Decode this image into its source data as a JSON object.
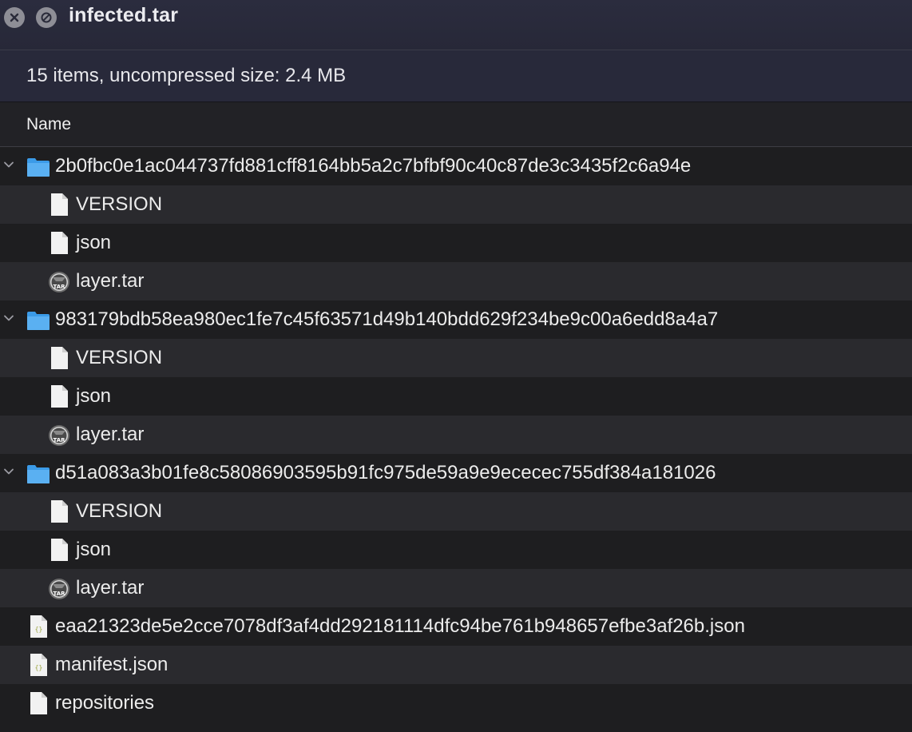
{
  "window": {
    "title": "infected.tar"
  },
  "info": {
    "summary": "15 items, uncompressed size: 2.4 MB"
  },
  "columns": {
    "name": "Name"
  },
  "colors": {
    "folder": "#3b9be8",
    "file": "#f2f2f2",
    "archive": "#6c6c6c"
  },
  "rows": [
    {
      "label": "2b0fbc0e1ac044737fd881cff8164bb5a2c7bfbf90c40c87de3c3435f2c6a94e",
      "type": "folder",
      "level": 0,
      "expanded": true
    },
    {
      "label": "VERSION",
      "type": "file",
      "level": 1
    },
    {
      "label": "json",
      "type": "file",
      "level": 1
    },
    {
      "label": "layer.tar",
      "type": "tar",
      "level": 1
    },
    {
      "label": "983179bdb58ea980ec1fe7c45f63571d49b140bdd629f234be9c00a6edd8a4a7",
      "type": "folder",
      "level": 0,
      "expanded": true
    },
    {
      "label": "VERSION",
      "type": "file",
      "level": 1
    },
    {
      "label": "json",
      "type": "file",
      "level": 1
    },
    {
      "label": "layer.tar",
      "type": "tar",
      "level": 1
    },
    {
      "label": "d51a083a3b01fe8c58086903595b91fc975de59a9e9ececec755df384a181026",
      "type": "folder",
      "level": 0,
      "expanded": true
    },
    {
      "label": "VERSION",
      "type": "file",
      "level": 1
    },
    {
      "label": "json",
      "type": "file",
      "level": 1
    },
    {
      "label": "layer.tar",
      "type": "tar",
      "level": 1
    },
    {
      "label": "eaa21323de5e2cce7078df3af4dd292181114dfc94be761b948657efbe3af26b.json",
      "type": "json",
      "level": 0
    },
    {
      "label": "manifest.json",
      "type": "json",
      "level": 0
    },
    {
      "label": "repositories",
      "type": "file",
      "level": 0
    }
  ]
}
